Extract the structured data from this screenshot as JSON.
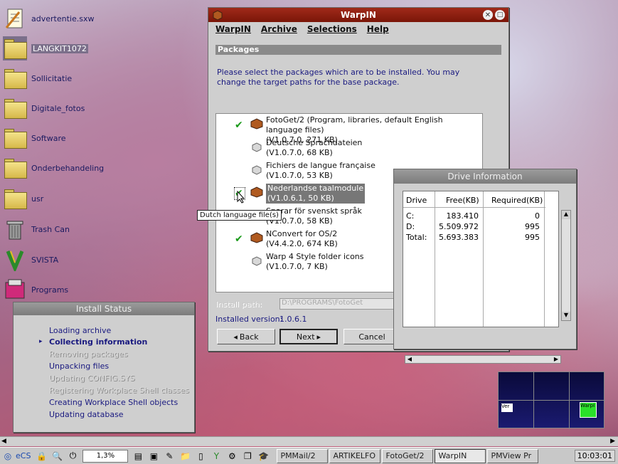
{
  "desktop": {
    "icons": [
      {
        "label": "advertentie.sxw",
        "icon": "document-icon"
      },
      {
        "label": "LANGKIT1072",
        "icon": "folder-icon"
      },
      {
        "label": "Sollicitatie",
        "icon": "folder-icon"
      },
      {
        "label": "Digitale_fotos",
        "icon": "folder-icon"
      },
      {
        "label": "Software",
        "icon": "folder-icon"
      },
      {
        "label": "Onderbehandeling",
        "icon": "folder-icon"
      },
      {
        "label": "usr",
        "icon": "folder-icon"
      },
      {
        "label": "Trash Can",
        "icon": "trash-icon"
      },
      {
        "label": "SVISTA",
        "icon": "svista-icon"
      },
      {
        "label": "Programs",
        "icon": "programs-icon"
      }
    ]
  },
  "warpin": {
    "title": "WarpIN",
    "menu": [
      "WarpIN",
      "Archive",
      "Selections",
      "Help"
    ],
    "section": "Packages",
    "instruction": "Please select the packages which are to be installed. You may change the target paths for the base package.",
    "packages": [
      {
        "line1": "FotoGet/2 (Program, libraries, default English language files)",
        "line2": "(V1.0.7.0, 271 KB)",
        "checked": true
      },
      {
        "line1": "Deutsche Sprachdateien",
        "line2": "(V1.0.7.0, 68 KB)",
        "checked": false
      },
      {
        "line1": "Fichiers de langue française",
        "line2": "(V1.0.7.0, 53 KB)",
        "checked": false
      },
      {
        "line1": "Nederlandse taalmodule",
        "line2": "(V1.0.6.1, 50 KB)",
        "checked": true
      },
      {
        "line1": "Sparar för svenskt språk",
        "line2": "(V1.0.7.0, 58 KB)",
        "checked": false
      },
      {
        "line1": "NConvert for OS/2",
        "line2": "(V4.4.2.0, 674 KB)",
        "checked": true
      },
      {
        "line1": "Warp 4 Style folder icons",
        "line2": "(V1.0.7.0, 7 KB)",
        "checked": false
      }
    ],
    "tooltip": "Dutch language file(s)",
    "install_path_label": "Install path:",
    "install_path_value": "D:\\PROGRAMS\\FotoGet",
    "installed_version_label": "Installed version:",
    "installed_version_value": "1.0.6.1",
    "back_label": "Back",
    "next_label": "Next",
    "cancel_label": "Cancel"
  },
  "drive_info": {
    "title": "Drive Information",
    "headers": [
      "Drive",
      "Free(KB)",
      "Required(KB)"
    ],
    "rows": [
      [
        "C:",
        "183.410",
        "0"
      ],
      [
        "D:",
        "5.509.972",
        "995"
      ],
      [
        "Total:",
        "5.693.383",
        "995"
      ]
    ]
  },
  "install_status": {
    "title": "Install Status",
    "items": [
      {
        "label": "Loading archive",
        "state": "done"
      },
      {
        "label": "Collecting information",
        "state": "current"
      },
      {
        "label": "Removing packages",
        "state": "pending"
      },
      {
        "label": "Unpacking files",
        "state": "done"
      },
      {
        "label": "Updating CONFIG.SYS",
        "state": "pending"
      },
      {
        "label": "Registering Workplace Shell classes",
        "state": "pending"
      },
      {
        "label": "Creating Workplace Shell objects",
        "state": "done"
      },
      {
        "label": "Updating database",
        "state": "done"
      }
    ]
  },
  "pager": {
    "label1": "Ver",
    "label2": "WarpI"
  },
  "taskbar": {
    "ecs_label": "eCS",
    "cpu_label": "1,3%",
    "tasks": [
      "PMMail/2",
      "ARTIKELFO",
      "FotoGet/2",
      "WarpIN",
      "PMView Pr"
    ],
    "clock": "10:03:01"
  }
}
